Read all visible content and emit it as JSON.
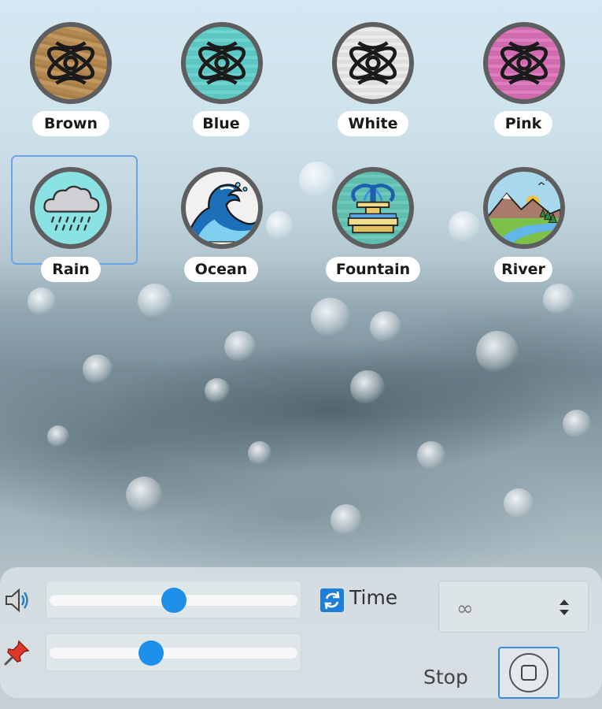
{
  "sounds": [
    {
      "id": "brown",
      "label": "Brown",
      "icon": "atom-icon",
      "color": "#b58b55",
      "selected": false
    },
    {
      "id": "blue",
      "label": "Blue",
      "icon": "atom-icon",
      "color": "#5ec8c4",
      "selected": false
    },
    {
      "id": "white",
      "label": "White",
      "icon": "atom-icon",
      "color": "#e2e2e2",
      "selected": false
    },
    {
      "id": "pink",
      "label": "Pink",
      "icon": "atom-icon",
      "color": "#d46fb4",
      "selected": false
    },
    {
      "id": "rain",
      "label": "Rain",
      "icon": "rain-cloud-icon",
      "color": "#8de3e4",
      "selected": true
    },
    {
      "id": "ocean",
      "label": "Ocean",
      "icon": "wave-icon",
      "color": "#f1f1f1",
      "selected": false
    },
    {
      "id": "fountain",
      "label": "Fountain",
      "icon": "fountain-icon",
      "color": "#66c2b4",
      "selected": false
    },
    {
      "id": "river",
      "label": "River",
      "icon": "river-landscape-icon",
      "color": "#9fd0e6",
      "selected": false
    }
  ],
  "controls": {
    "volume": {
      "icon": "speaker-icon",
      "value": 0.5
    },
    "pin": {
      "icon": "pushpin-icon",
      "value": 0.4
    },
    "time": {
      "icon": "loop-icon",
      "label": "Time",
      "value": "∞",
      "control_icon": "stepper-icon"
    },
    "stop": {
      "label": "Stop",
      "icon": "stop-icon"
    }
  },
  "colors": {
    "accent": "#1e8fe8",
    "selection_border": "#6aa6e6",
    "circle_border": "#5e5e5e"
  }
}
